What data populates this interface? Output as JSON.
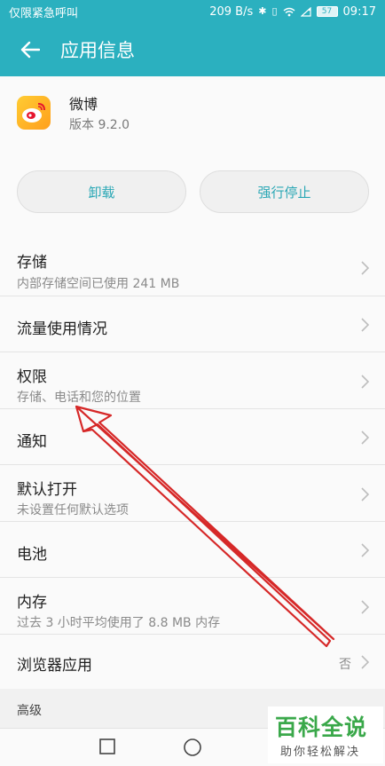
{
  "status_bar": {
    "left_text": "仅限紧急呼叫",
    "network_speed": "209 B/s",
    "battery_level": "57",
    "time": "09:17"
  },
  "app_bar": {
    "title": "应用信息"
  },
  "app": {
    "name": "微博",
    "version": "版本 9.2.0"
  },
  "buttons": {
    "uninstall": "卸载",
    "force_stop": "强行停止"
  },
  "settings": [
    {
      "title": "存储",
      "subtitle": "内部存储空间已使用 241 MB"
    },
    {
      "title": "流量使用情况"
    },
    {
      "title": "权限",
      "subtitle": "存储、电话和您的位置"
    },
    {
      "title": "通知"
    },
    {
      "title": "默认打开",
      "subtitle": "未设置任何默认选项"
    },
    {
      "title": "电池"
    },
    {
      "title": "内存",
      "subtitle": "过去 3 小时平均使用了 8.8 MB 内存"
    },
    {
      "title": "浏览器应用",
      "value": "否"
    }
  ],
  "section": {
    "title": "高级"
  },
  "watermark": {
    "main": "百科全说",
    "sub": "助你轻松解决"
  },
  "colors": {
    "accent": "#2bb0bf",
    "button_text": "#2aa7b5",
    "annotation_arrow": "#d62828"
  }
}
